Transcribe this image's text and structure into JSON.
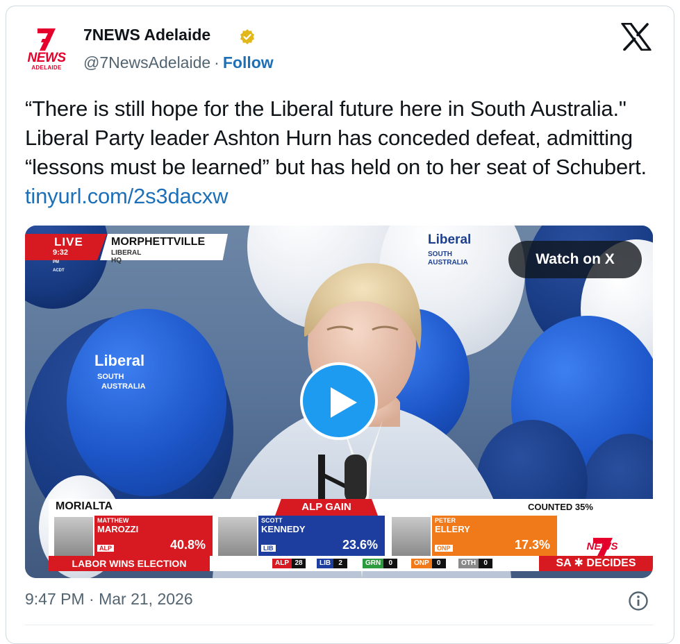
{
  "account": {
    "display_name": "7NEWS Adelaide",
    "handle": "@7NewsAdelaide",
    "separator": "·",
    "follow_label": "Follow",
    "avatar_brand": "NEWS",
    "avatar_city": "ADELAIDE",
    "verified": "gold-verified-badge-icon"
  },
  "platform_icon": "x-logo-icon",
  "tweet": {
    "text": "“There is still hope for the Liberal future here in South Australia.\" Liberal Party leader Ashton Hurn has conceded defeat, admitting “lessons must be learned” but has held on to her seat of Schubert. ",
    "link": "tinyurl.com/2s3dacxw"
  },
  "video": {
    "watch_label": "Watch on X",
    "play_icon": "play-icon",
    "live": {
      "label": "LIVE",
      "time": "9:32",
      "time_suffix": "PM ACDT",
      "location": "MORPHETTVILLE",
      "sub": "LIBERAL HQ"
    },
    "balloon_text": {
      "brand": "Liberal",
      "region_line1": "SOUTH",
      "region_line2": "AUSTRALIA"
    },
    "lower_third": {
      "seat": "MORIALTA",
      "gain": "ALP GAIN",
      "counted": "COUNTED 35%",
      "candidates": [
        {
          "first": "MATTHEW",
          "last": "MAROZZI",
          "party": "ALP",
          "pct": "40.8%",
          "color": "#d71a21"
        },
        {
          "first": "SCOTT",
          "last": "KENNEDY",
          "party": "LIB",
          "pct": "23.6%",
          "color": "#1d3e9e"
        },
        {
          "first": "PETER",
          "last": "ELLERY",
          "party": "ONP",
          "pct": "17.3%",
          "color": "#f07a1a"
        }
      ],
      "headline": "LABOR WINS ELECTION",
      "seats": [
        {
          "party": "ALP",
          "count": "28",
          "color": "#d71a21"
        },
        {
          "party": "LIB",
          "count": "2",
          "color": "#1d3e9e"
        },
        {
          "party": "GRN",
          "count": "0",
          "color": "#2e9a3e"
        },
        {
          "party": "ONP",
          "count": "0",
          "color": "#f07a1a"
        },
        {
          "party": "OTH",
          "count": "0",
          "color": "#8a8a8a"
        }
      ],
      "brand": "NEWS",
      "show": "SA ✱ DECIDES"
    }
  },
  "footer": {
    "timestamp": "9:47 PM · Mar 21, 2026",
    "info_icon": "info-icon"
  },
  "colors": {
    "link": "#1d70b8",
    "secondary_text": "#536471",
    "seven_red": "#e4002b",
    "play_blue": "#1d9bf0"
  }
}
